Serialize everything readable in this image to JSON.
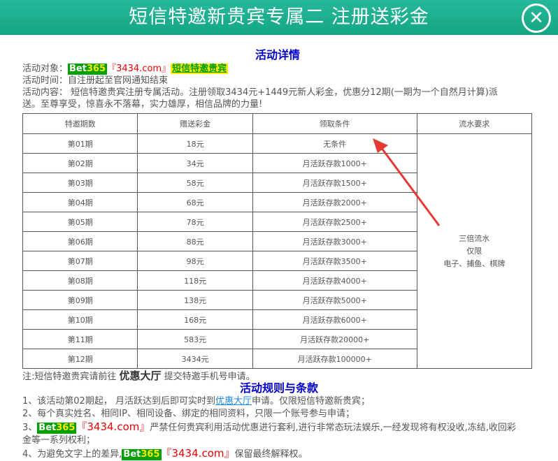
{
  "header": {
    "title": "短信特邀新贵宾专属二 注册送彩金",
    "close_icon": "close-icon"
  },
  "details": {
    "heading": "活动详情",
    "target_label": "活动对象：",
    "brand_prefix": "Bet",
    "brand_num": "365",
    "site": "『3434.com』",
    "vip_tag": "短信特邀贵宾",
    "time_text": "活动时间：自注册起至官网通知结束",
    "content_line1": "活动内容： 短信特邀贵宾注册专属活动。注册领取3434元+1449元新人彩金，优惠分12期(一期为一个自然月计算)派",
    "content_line2": "送。至尊享受，惊喜永不落幕，实力雄厚，相信品牌的力量!"
  },
  "table": {
    "headers": [
      "特邀期数",
      "赠送彩金",
      "领取条件",
      "流水要求"
    ],
    "rows": [
      [
        "第01期",
        "18元",
        "无条件"
      ],
      [
        "第02期",
        "34元",
        "月活跃存款1000+"
      ],
      [
        "第03期",
        "58元",
        "月活跃存款1500+"
      ],
      [
        "第04期",
        "68元",
        "月活跃存款2000+"
      ],
      [
        "第05期",
        "78元",
        "月活跃存款2500+"
      ],
      [
        "第06期",
        "88元",
        "月活跃存款3000+"
      ],
      [
        "第07期",
        "98元",
        "月活跃存款3500+"
      ],
      [
        "第08期",
        "118元",
        "月活跃存款4000+"
      ],
      [
        "第09期",
        "138元",
        "月活跃存款5000+"
      ],
      [
        "第10期",
        "168元",
        "月活跃存款6000+"
      ],
      [
        "第11期",
        "583元",
        "月活跃存款20000+"
      ],
      [
        "第12期",
        "3434元",
        "月活跃存款100000+"
      ]
    ],
    "requirement": [
      "三倍流水",
      "仅限",
      "电子、捕鱼、棋牌"
    ]
  },
  "note": {
    "prefix": "注:短信特邀贵宾请前往 ",
    "hall": "优惠大厅",
    "suffix": " 提交特邀手机号申请。"
  },
  "rules": {
    "heading": "活动规则与条款",
    "r1_a": "1、该活动第02期起， 月活跃达到后即可实时到",
    "r1_link": "优惠大厅",
    "r1_b": "申请。仅限短信特邀新贵宾；",
    "r2": "2、每个真实姓名、相同IP、相同设备、绑定的相同资料，只限一个账号参与申请；",
    "r3_prefix": "3、",
    "r3_text": "严禁任何贵宾利用活动优惠进行套利,进行非常态玩法娱乐,一经发现将有权没收,冻结,收回彩",
    "r3_line2": "金等一系列权利；",
    "r4_a": "4、为避免文字上的差异,",
    "r4_b": "保留最终解释权。"
  },
  "colors": {
    "header": "#1aa98a",
    "heading": "#0000cc",
    "brand_bg": "#00a000",
    "arrow": "#e53935"
  }
}
